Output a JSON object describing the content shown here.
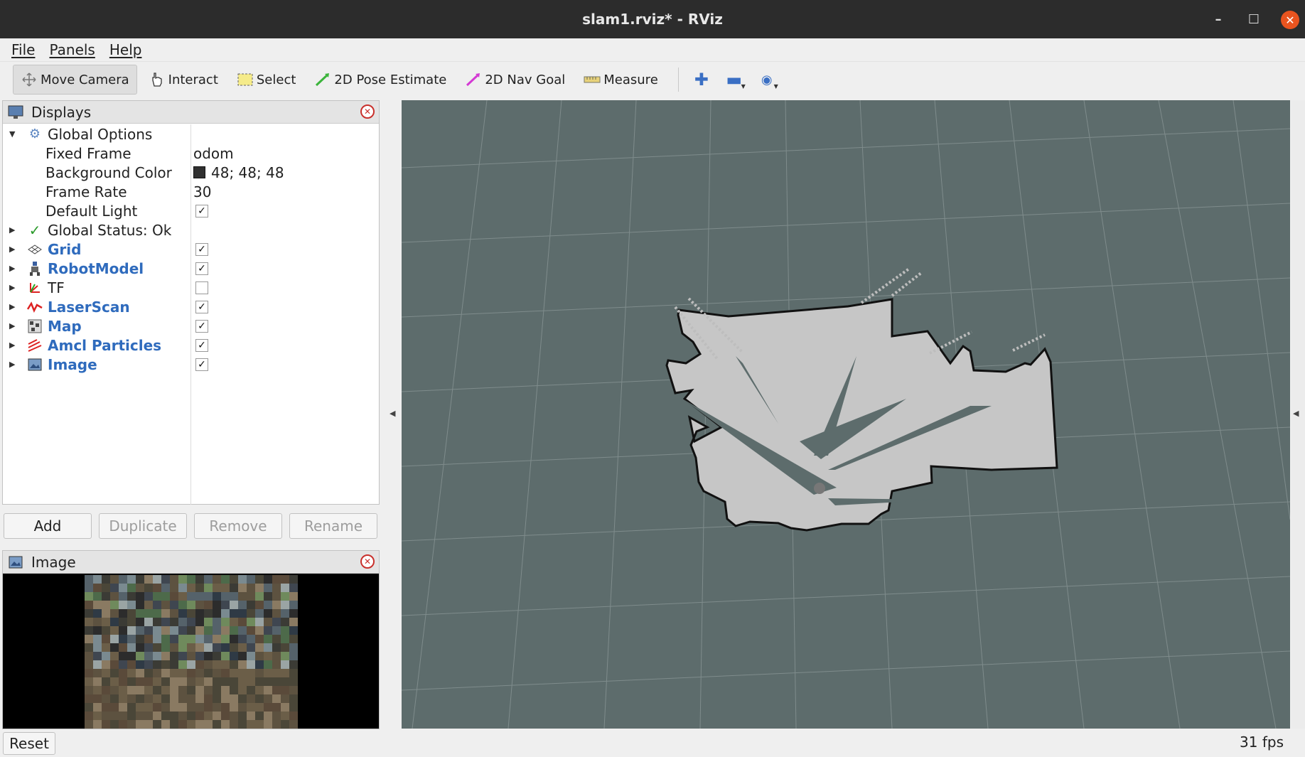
{
  "window": {
    "title": "slam1.rviz* - RViz"
  },
  "menu": [
    "File",
    "Panels",
    "Help"
  ],
  "toolbar": {
    "tools": [
      {
        "label": "Move Camera",
        "icon": "move-camera-icon",
        "active": true
      },
      {
        "label": "Interact",
        "icon": "hand-icon"
      },
      {
        "label": "Select",
        "icon": "select-icon"
      },
      {
        "label": "2D Pose Estimate",
        "icon": "green-arrow-icon"
      },
      {
        "label": "2D Nav Goal",
        "icon": "magenta-arrow-icon"
      },
      {
        "label": "Measure",
        "icon": "ruler-icon"
      }
    ]
  },
  "displays": {
    "title": "Displays",
    "global_options": {
      "label": "Global Options",
      "fixed_frame_label": "Fixed Frame",
      "fixed_frame_value": "odom",
      "bg_color_label": "Background Color",
      "bg_color_value": "48; 48; 48",
      "frame_rate_label": "Frame Rate",
      "frame_rate_value": "30",
      "default_light_label": "Default Light"
    },
    "global_status": "Global Status: Ok",
    "items": [
      {
        "label": "Grid",
        "checked": true,
        "icon": "grid-icon",
        "blue": true
      },
      {
        "label": "RobotModel",
        "checked": true,
        "icon": "robot-icon",
        "blue": true
      },
      {
        "label": "TF",
        "checked": false,
        "icon": "tf-icon",
        "blue": false
      },
      {
        "label": "LaserScan",
        "checked": true,
        "icon": "laserscan-icon",
        "blue": true
      },
      {
        "label": "Map",
        "checked": true,
        "icon": "map-icon",
        "blue": true
      },
      {
        "label": "Amcl Particles",
        "checked": true,
        "icon": "particles-icon",
        "blue": true
      },
      {
        "label": "Image",
        "checked": true,
        "icon": "image-icon",
        "blue": true
      }
    ],
    "buttons": {
      "add": "Add",
      "duplicate": "Duplicate",
      "remove": "Remove",
      "rename": "Rename"
    }
  },
  "image_panel": {
    "title": "Image"
  },
  "statusbar": {
    "reset": "Reset",
    "fps": "31 fps"
  }
}
